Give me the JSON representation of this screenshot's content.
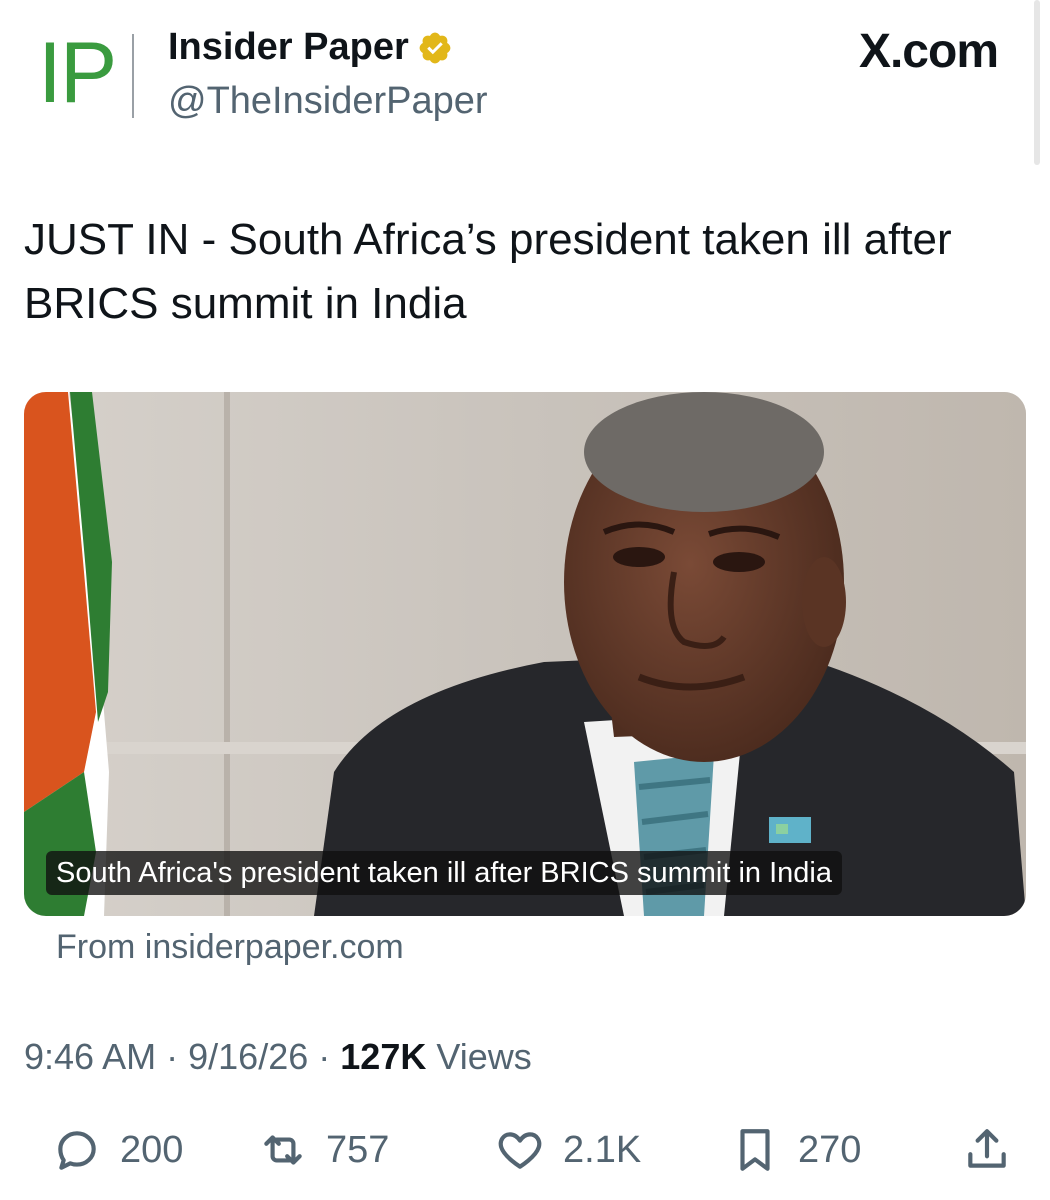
{
  "header": {
    "logo_text": "IP",
    "name": "Insider Paper",
    "verified_icon": "verified-badge-icon",
    "handle": "@TheInsiderPaper",
    "platform": "X.com"
  },
  "tweet": {
    "text": "JUST IN - South Africa’s president taken ill after BRICS summit in India",
    "media": {
      "caption": "South Africa's president taken ill after BRICS summit in India",
      "source": "From insiderpaper.com"
    },
    "time": "9:46 AM",
    "date": "9/16/26",
    "views_count": "127K",
    "views_label": "Views",
    "separator": "·"
  },
  "actions": [
    {
      "icon": "reply-icon",
      "count": "200"
    },
    {
      "icon": "retweet-icon",
      "count": "757"
    },
    {
      "icon": "like-icon",
      "count": "2.1K"
    },
    {
      "icon": "bookmark-icon",
      "count": "270"
    },
    {
      "icon": "share-icon",
      "count": ""
    }
  ],
  "colors": {
    "logo_green": "#3a9b3f",
    "verified_gold": "#e2b719",
    "text_primary": "#0f1419",
    "text_secondary": "#536471"
  }
}
